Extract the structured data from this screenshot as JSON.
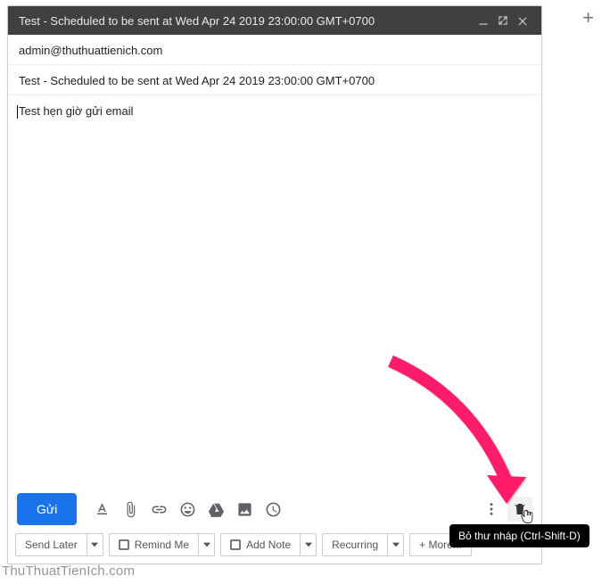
{
  "page": {
    "plus": "+"
  },
  "titlebar": {
    "title": "Test - Scheduled to be sent at Wed Apr 24 2019 23:00:00 GMT+0700"
  },
  "recipients": {
    "to": "admin@thuthuattienich.com"
  },
  "subject": {
    "text": "Test - Scheduled to be sent at Wed Apr 24 2019 23:00:00 GMT+0700"
  },
  "body": {
    "text": "Test hẹn giờ gửi email"
  },
  "toolbar": {
    "send": "Gửi",
    "send_later": "Send Later",
    "remind_me": "Remind Me",
    "add_note": "Add Note",
    "recurring": "Recurring",
    "more": "+ More..."
  },
  "tooltip": {
    "discard": "Bỏ thư nháp (Ctrl-Shift-D)"
  },
  "watermark": {
    "text": "ThuThuatTienIch.com"
  }
}
